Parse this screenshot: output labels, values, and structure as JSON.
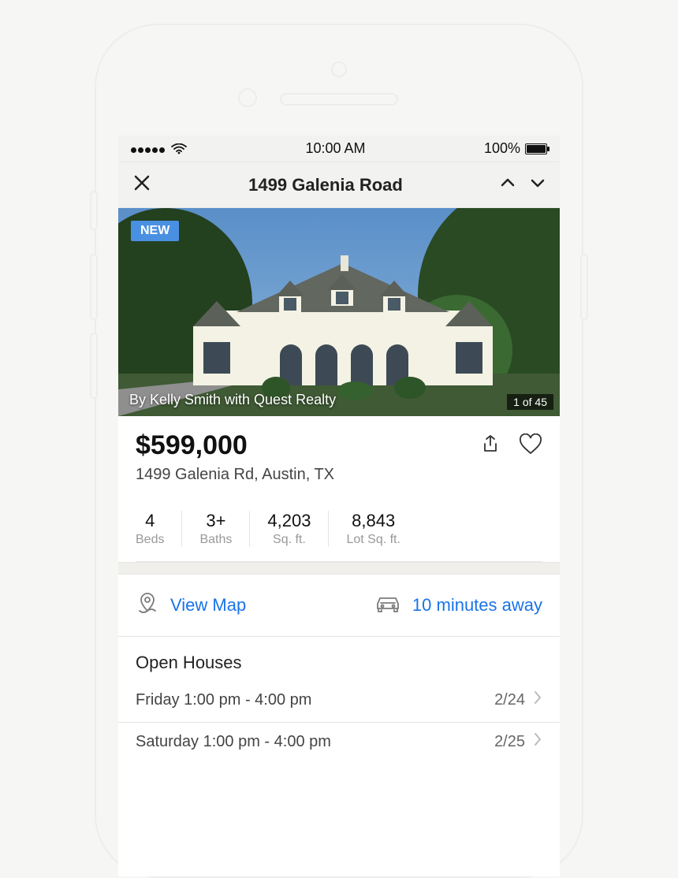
{
  "status": {
    "time": "10:00 AM",
    "battery": "100%"
  },
  "nav": {
    "title": "1499 Galenia Road"
  },
  "photo": {
    "badge": "NEW",
    "byline": "By Kelly Smith with Quest Realty",
    "counter": "1 of 45"
  },
  "listing": {
    "price": "$599,000",
    "address": "1499 Galenia Rd, Austin, TX"
  },
  "stats": {
    "beds_val": "4",
    "beds_lbl": "Beds",
    "baths_val": "3+",
    "baths_lbl": "Baths",
    "sqft_val": "4,203",
    "sqft_lbl": "Sq. ft.",
    "lot_val": "8,843",
    "lot_lbl": "Lot Sq. ft."
  },
  "links": {
    "map": "View Map",
    "commute": "10 minutes away"
  },
  "open_houses": {
    "title": "Open Houses",
    "rows": [
      {
        "time": "Friday 1:00 pm - 4:00 pm",
        "date": "2/24"
      },
      {
        "time": "Saturday 1:00 pm - 4:00 pm",
        "date": "2/25"
      }
    ]
  }
}
